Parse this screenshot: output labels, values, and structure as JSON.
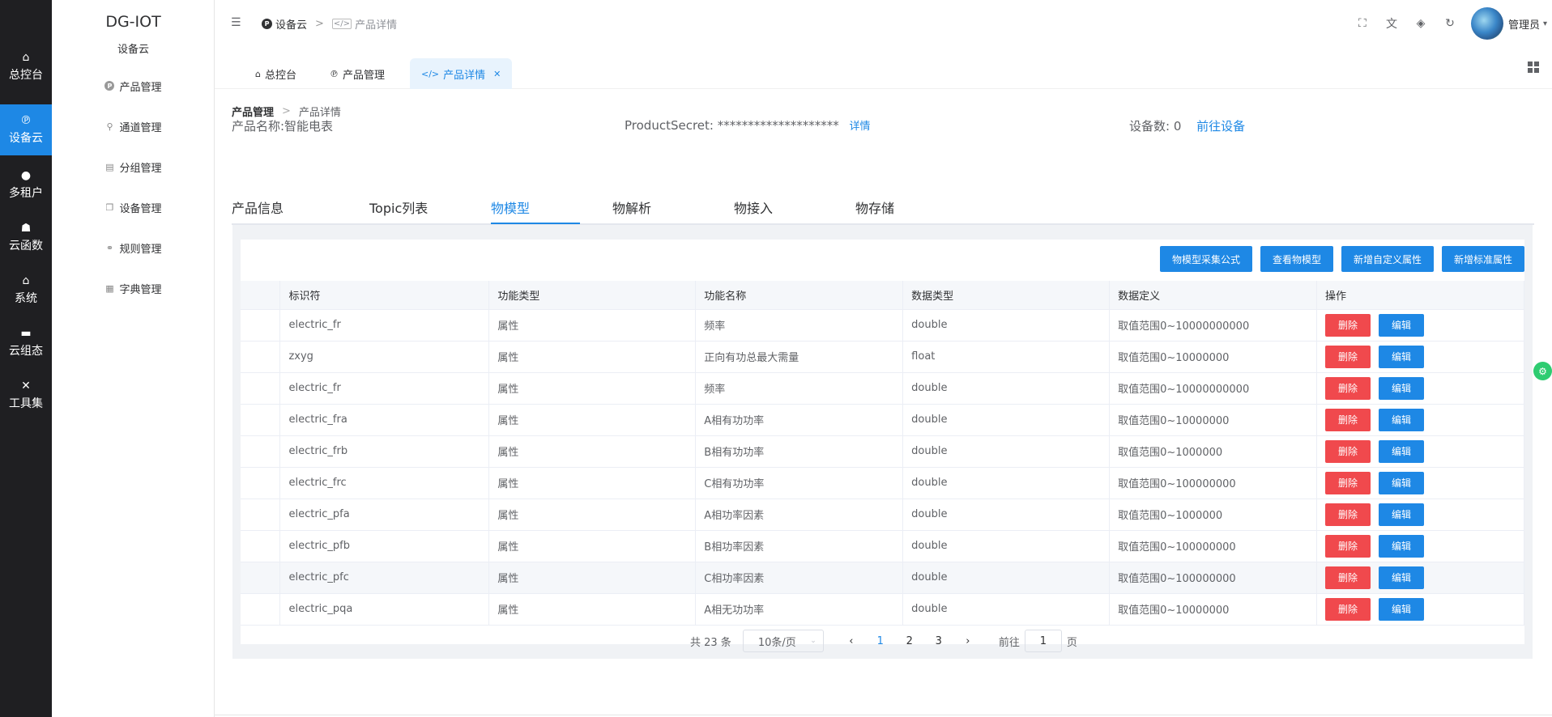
{
  "rail": [
    {
      "label": "总控台",
      "icon": "home-icon",
      "glyph": "⌂"
    },
    {
      "label": "设备云",
      "icon": "p-circle-icon",
      "glyph": "℗"
    },
    {
      "label": "多租户",
      "icon": "user-icon",
      "glyph": "●"
    },
    {
      "label": "云函数",
      "icon": "users-icon",
      "glyph": "☗"
    },
    {
      "label": "系统",
      "icon": "house-icon",
      "glyph": "⌂"
    },
    {
      "label": "云组态",
      "icon": "card-icon",
      "glyph": "▬"
    },
    {
      "label": "工具集",
      "icon": "tools-icon",
      "glyph": "✕"
    }
  ],
  "brand": {
    "title": "DG-IOT",
    "subtitle": "设备云"
  },
  "submenu": [
    {
      "label": "产品管理",
      "icon": "product-icon"
    },
    {
      "label": "通道管理",
      "icon": "channel-icon"
    },
    {
      "label": "分组管理",
      "icon": "group-icon"
    },
    {
      "label": "设备管理",
      "icon": "device-icon"
    },
    {
      "label": "规则管理",
      "icon": "rule-icon"
    },
    {
      "label": "字典管理",
      "icon": "dict-icon"
    }
  ],
  "header": {
    "crumb_root": "设备云",
    "crumb_sep": ">",
    "crumb_current": "产品详情",
    "user": "管理员"
  },
  "tags": [
    {
      "label": "总控台"
    },
    {
      "label": "产品管理"
    },
    {
      "label": "产品详情"
    }
  ],
  "page_crumb": {
    "root": "产品管理",
    "sep": ">",
    "current": "产品详情"
  },
  "product": {
    "name_label": "产品名称:智能电表",
    "secret_label": "ProductSecret: ********************",
    "secret_link": "详情",
    "device_count_label": "设备数: 0",
    "device_link": "前往设备"
  },
  "tabs": [
    "产品信息",
    "Topic列表",
    "物模型",
    "物解析",
    "物接入",
    "物存储"
  ],
  "active_tab": "物模型",
  "actions": [
    "物模型采集公式",
    "查看物模型",
    "新增自定义属性",
    "新增标准属性"
  ],
  "table": {
    "columns": [
      "",
      "标识符",
      "功能类型",
      "功能名称",
      "数据类型",
      "数据定义",
      "操作"
    ],
    "rows": [
      [
        "",
        "electric_fr",
        "属性",
        "频率",
        "double",
        "取值范围0~10000000000"
      ],
      [
        "",
        "zxyg",
        "属性",
        "正向有功总最大需量",
        "float",
        "取值范围0~10000000"
      ],
      [
        "",
        "electric_fr",
        "属性",
        "频率",
        "double",
        "取值范围0~10000000000"
      ],
      [
        "",
        "electric_fra",
        "属性",
        "A相有功功率",
        "double",
        "取值范围0~10000000"
      ],
      [
        "",
        "electric_frb",
        "属性",
        "B相有功功率",
        "double",
        "取值范围0~1000000"
      ],
      [
        "",
        "electric_frc",
        "属性",
        "C相有功功率",
        "double",
        "取值范围0~100000000"
      ],
      [
        "",
        "electric_pfa",
        "属性",
        "A相功率因素",
        "double",
        "取值范围0~1000000"
      ],
      [
        "",
        "electric_pfb",
        "属性",
        "B相功率因素",
        "double",
        "取值范围0~100000000"
      ],
      [
        "",
        "electric_pfc",
        "属性",
        "C相功率因素",
        "double",
        "取值范围0~100000000"
      ],
      [
        "",
        "electric_pqa",
        "属性",
        "A相无功功率",
        "double",
        "取值范围0~10000000"
      ]
    ],
    "delete_label": "删除",
    "edit_label": "编辑"
  },
  "pagination": {
    "total": "共 23 条",
    "page_size": "10条/页",
    "pages": [
      "1",
      "2",
      "3"
    ],
    "current": "1",
    "goto_prefix": "前往",
    "goto_value": "1",
    "goto_suffix": "页"
  },
  "colors": {
    "accent": "#1e88e5",
    "danger": "#f0494d",
    "rail": "#1f1f22"
  }
}
